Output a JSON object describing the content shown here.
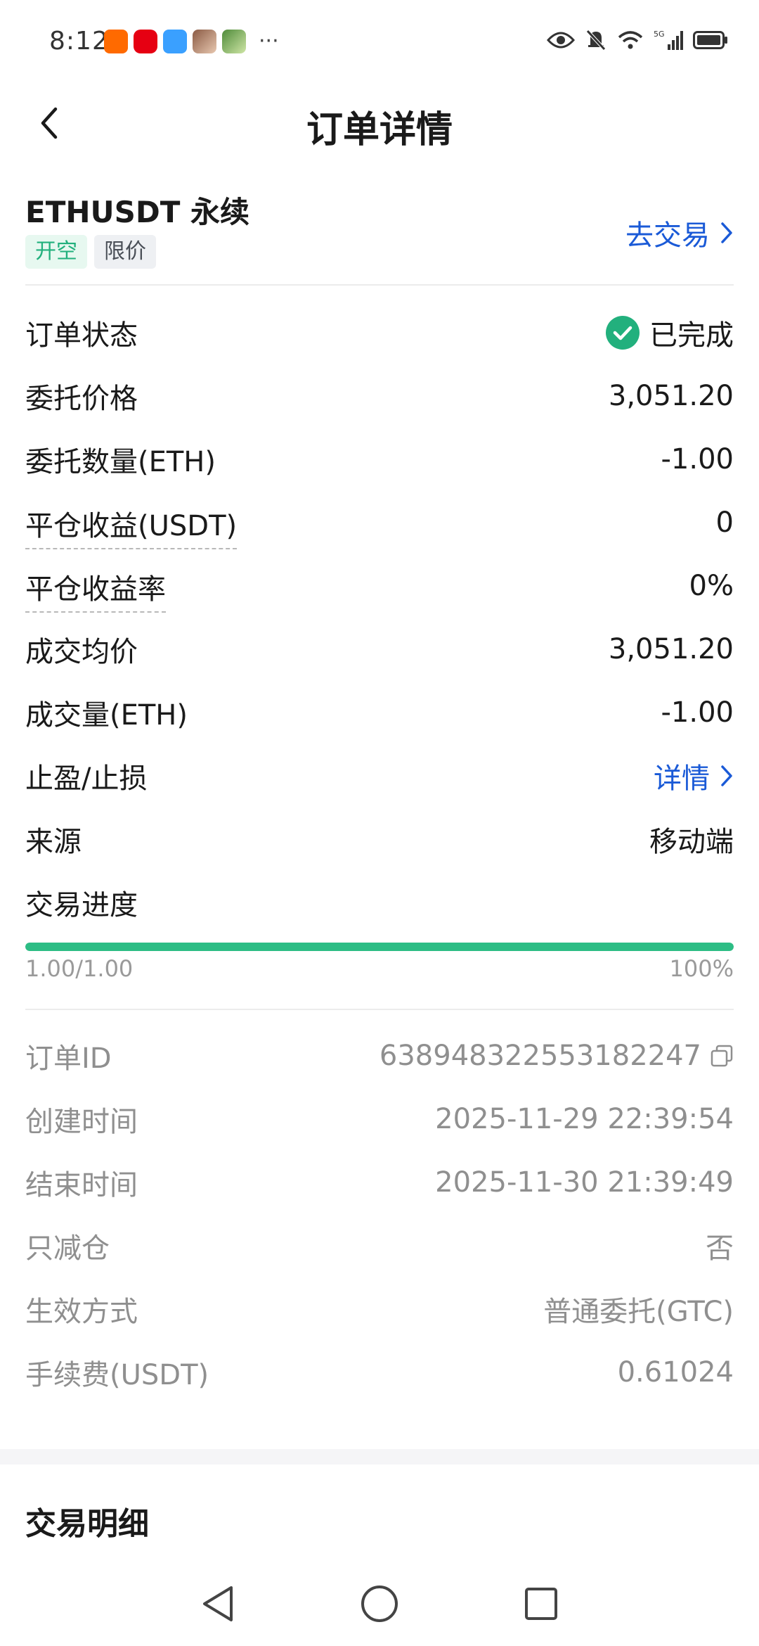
{
  "status_bar": {
    "time": "8:12",
    "more": "···",
    "network": "5G"
  },
  "header": {
    "title": "订单详情"
  },
  "order": {
    "symbol": "ETHUSDT 永续",
    "tags": [
      "开空",
      "限价"
    ],
    "goto_trade": "去交易",
    "colors": {
      "accent": "#1a5ad7",
      "green": "#22b07d",
      "progress": "#2dbd85"
    }
  },
  "details": {
    "status_label": "订单状态",
    "status_value": "已完成",
    "price_label": "委托价格",
    "price_value": "3,051.20",
    "qty_label": "委托数量(ETH)",
    "qty_value": "-1.00",
    "pnl_label": "平仓收益(USDT)",
    "pnl_value": "0",
    "pnl_rate_label": "平仓收益率",
    "pnl_rate_value": "0%",
    "avg_label": "成交均价",
    "avg_value": "3,051.20",
    "filled_label": "成交量(ETH)",
    "filled_value": "-1.00",
    "tpsl_label": "止盈/止损",
    "tpsl_value": "详情",
    "source_label": "来源",
    "source_value": "移动端",
    "progress_label": "交易进度",
    "progress_fraction": 1.0,
    "progress_left": "1.00/1.00",
    "progress_right": "100%"
  },
  "meta": {
    "order_id_label": "订单ID",
    "order_id_value": "638948322553182247",
    "created_label": "创建时间",
    "created_value": "2025-11-29 22:39:54",
    "ended_label": "结束时间",
    "ended_value": "2025-11-30 21:39:49",
    "reduce_only_label": "只减仓",
    "reduce_only_value": "否",
    "tif_label": "生效方式",
    "tif_value": "普通委托(GTC)",
    "fee_label": "手续费(USDT)",
    "fee_value": "0.61024"
  },
  "trade_detail": {
    "title": "交易明细"
  }
}
